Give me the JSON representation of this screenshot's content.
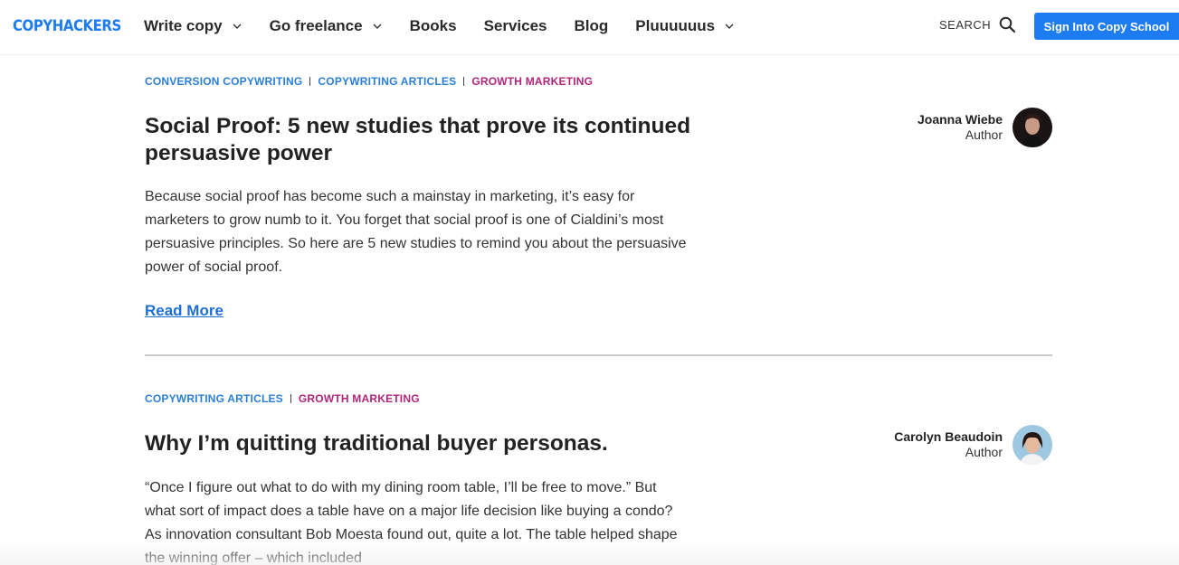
{
  "brand": {
    "logo_part1": "COPY",
    "logo_part2": "HACKERS",
    "color_primary": "#1d7cf2",
    "color_secondary": "#1c3d6e"
  },
  "nav": {
    "items": [
      {
        "label": "Write copy",
        "has_dropdown": true
      },
      {
        "label": "Go freelance",
        "has_dropdown": true
      },
      {
        "label": "Books",
        "has_dropdown": false
      },
      {
        "label": "Services",
        "has_dropdown": false
      },
      {
        "label": "Blog",
        "has_dropdown": false
      },
      {
        "label": "Pluuuuuus",
        "has_dropdown": true
      }
    ],
    "search_label": "SEARCH",
    "cta_label": "Sign Into Copy School"
  },
  "posts": [
    {
      "categories": [
        {
          "label": "CONVERSION COPYWRITING",
          "color": "#2b7fd9"
        },
        {
          "label": "COPYWRITING ARTICLES",
          "color": "#2b7fd9"
        },
        {
          "label": "GROWTH MARKETING",
          "color": "#b0257a"
        }
      ],
      "title": "Social Proof: 5 new studies that prove its continued persuasive power",
      "excerpt": "Because social proof has become such a mainstay in marketing, it’s easy for marketers to grow numb to it. You forget that social proof is one of Cialdini’s most persuasive principles. So here are 5 new studies to remind you about the persuasive power of social proof.",
      "read_more": "Read More",
      "author": {
        "name": "Joanna Wiebe",
        "role": "Author"
      }
    },
    {
      "categories": [
        {
          "label": "COPYWRITING ARTICLES",
          "color": "#2b7fd9"
        },
        {
          "label": "GROWTH MARKETING",
          "color": "#b0257a"
        }
      ],
      "title": "Why I’m quitting traditional buyer personas.",
      "excerpt": "“Once I figure out what to do with my dining room table, I’ll be free to move.” But what sort of impact does a table have on a major life decision like buying a condo? As innovation consultant Bob Moesta found out, quite a lot. The table helped shape the winning offer – which included",
      "author": {
        "name": "Carolyn Beaudoin",
        "role": "Author"
      }
    }
  ]
}
